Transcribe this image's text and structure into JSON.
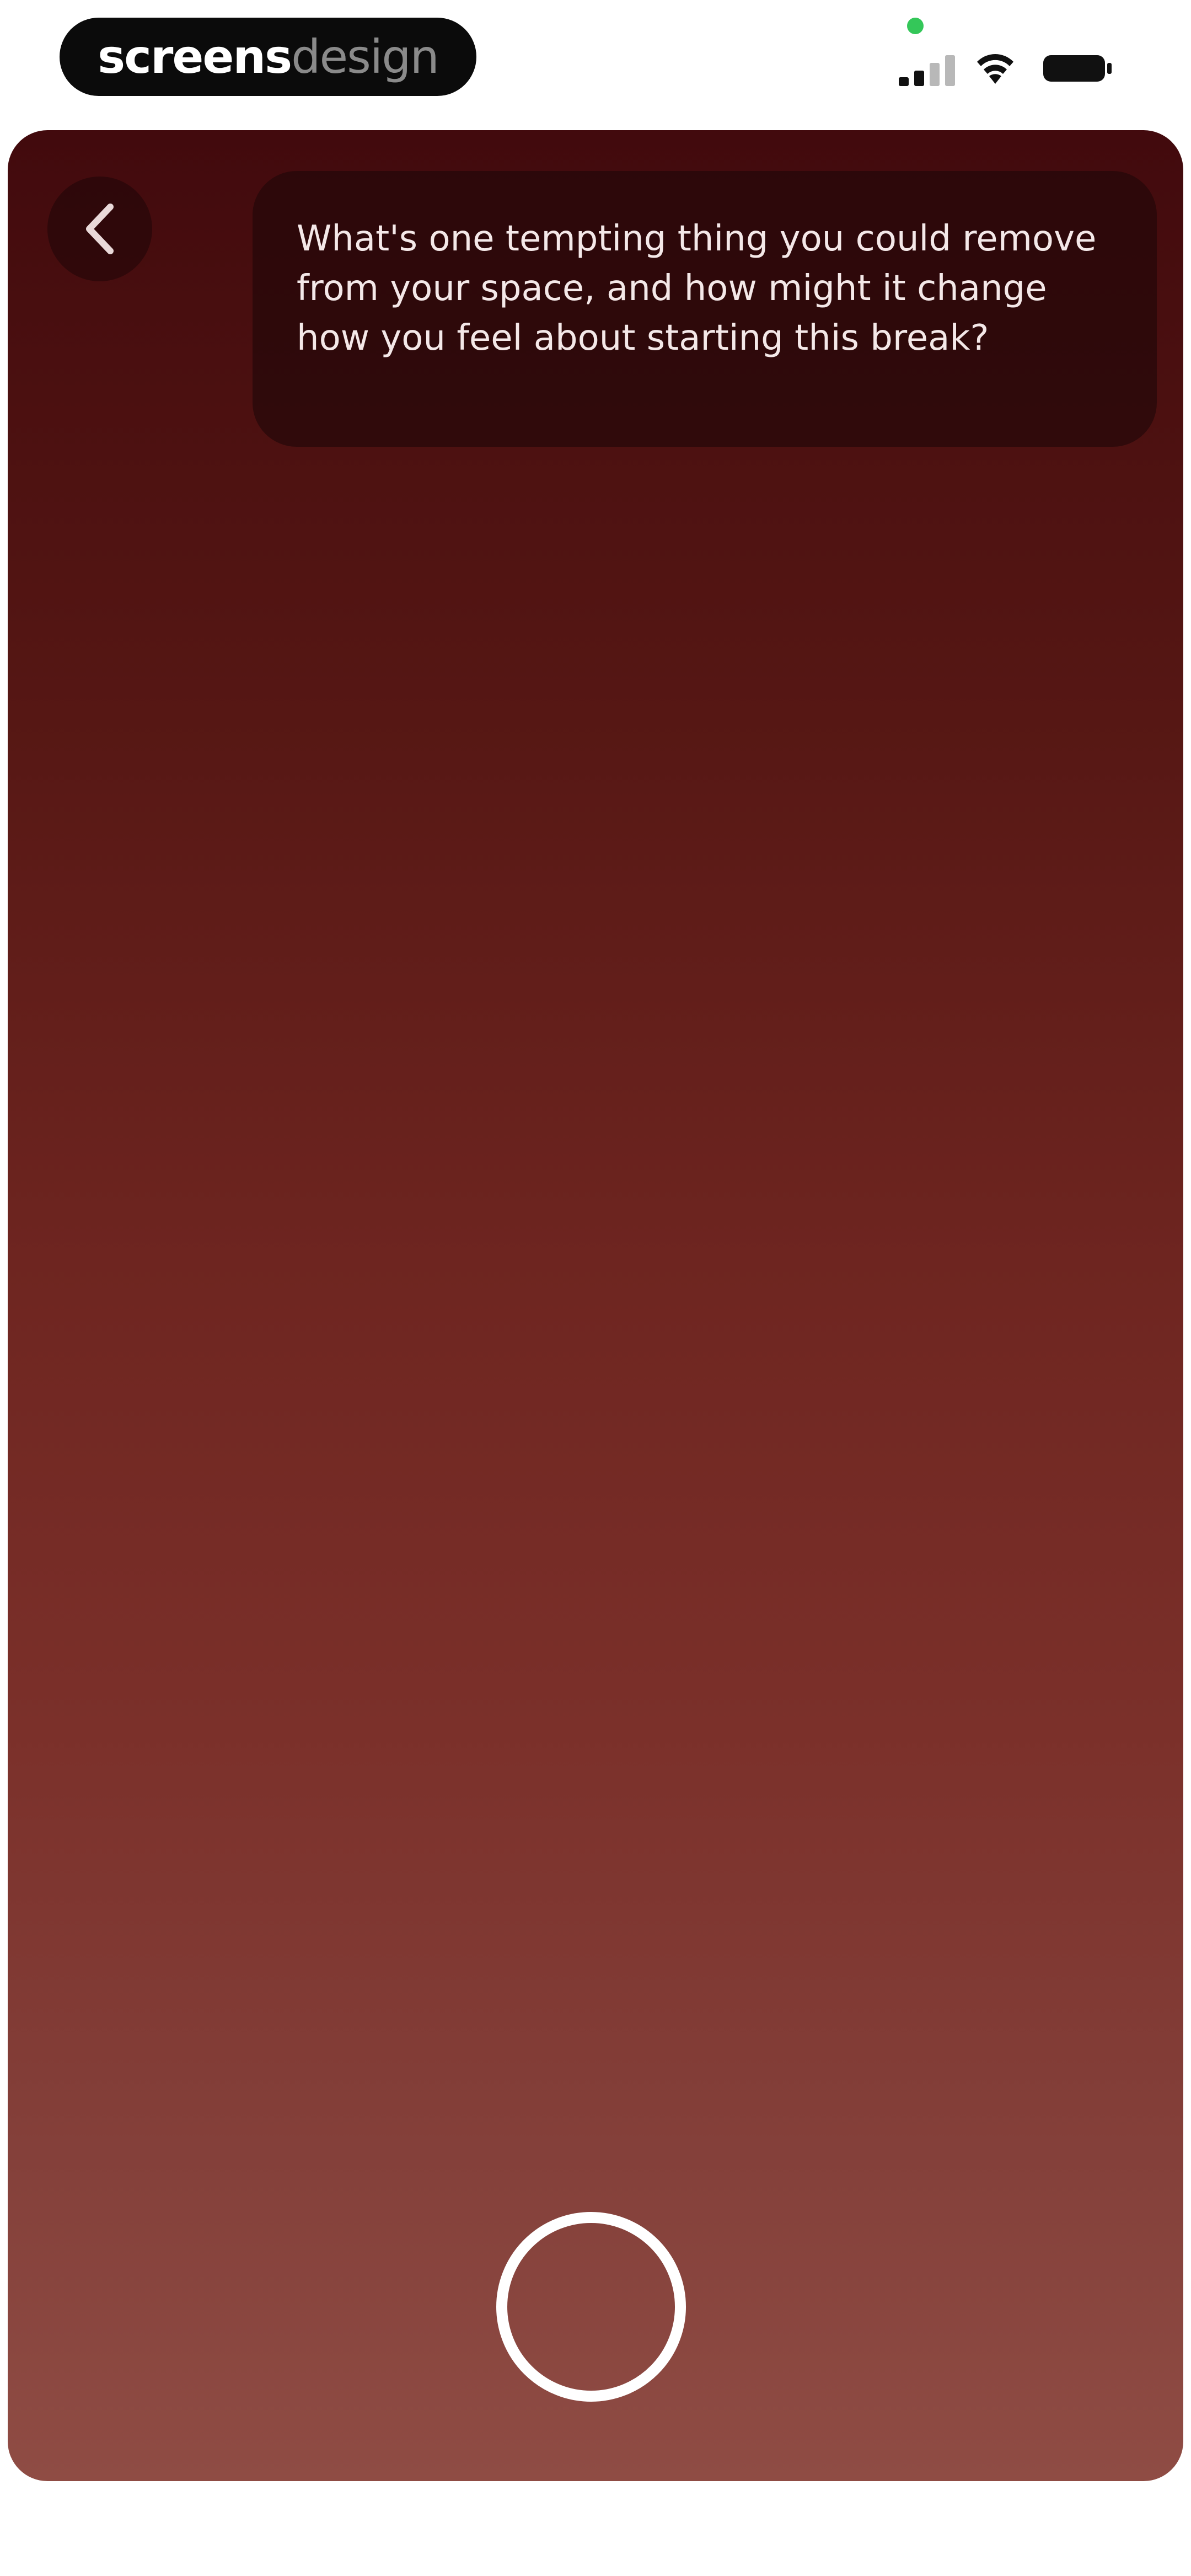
{
  "status_bar": {
    "brand": {
      "strong": "screens",
      "light": "design"
    },
    "privacy_indicator_color": "#34c759",
    "icons": [
      "signal-icon",
      "wifi-icon",
      "battery-icon"
    ]
  },
  "card": {
    "back_icon": "chevron-left-icon",
    "prompt": "What's one tempting thing you could remove from your space, and how might it change how you feel about starting this break?",
    "record_icon": "record-circle-icon",
    "colors": {
      "gradient_top": "#420a0d",
      "gradient_bottom": "#8f4c44",
      "bubble": "#1e0608",
      "ring": "#ffffff"
    }
  }
}
